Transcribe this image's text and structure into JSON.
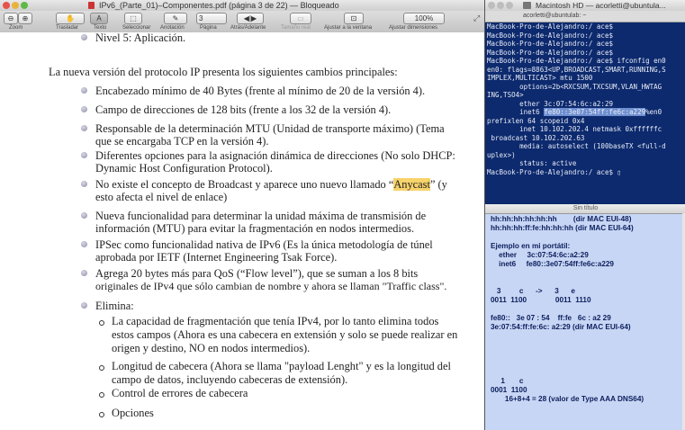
{
  "pdf_window": {
    "title": "IPv6_(Parte_01)–Componentes.pdf (página 3 de 22) — Bloqueado",
    "toolbar": {
      "zoom_label": "Zoom",
      "pan_label": "Trasladar",
      "text_label": "Texto",
      "select_label": "Seleccionar",
      "annotate_label": "Anotación",
      "page_label": "Página",
      "page_value": "3",
      "back_forward_label": "Atrás/Adelante",
      "actual_size_label": "Tamaño real",
      "fit_window_label": "Ajustar a la ventana",
      "zoom_value": "100%",
      "fit_dimensions_label": "Ajustar dimensiones"
    },
    "content": {
      "top_item": "Nivel 5: Aplicación.",
      "intro": "La nueva versión del protocolo IP presenta los siguientes cambios principales:",
      "bullets": [
        {
          "line1": "Encabezado mínimo de 40 Bytes (frente al mínimo de 20 de la versión 4)."
        },
        {
          "line1": "Campo de direcciones de 128 bits (frente a los 32 de la versión 4)."
        },
        {
          "line1": "Responsable de la determinación MTU (Unidad de transporte máximo) (Tema",
          "line2": "que se encargaba TCP en la versión 4)."
        },
        {
          "line1": "Diferentes opciones para la asignación dinámica de direcciones (No solo DHCP:",
          "line2": "Dynamic Host Configuration Protocol)."
        },
        {
          "line1_pre": "No existe el concepto de Broadcast y aparece uno nuevo llamado “",
          "line1_hl": "Anycast",
          "line1_post": "” (y",
          "line2": "esto afecta el nivel de enlace)"
        },
        {
          "line1": "Nueva funcionalidad para determinar la unidad máxima de transmisión de",
          "line2": "información (MTU) para evitar la fragmentación en nodos intermedios."
        },
        {
          "line1": "IPSec como funcionalidad nativa de IPv6 (Es la única metodología de túnel",
          "line2": "aprobada por IETF (Internet Engineering Tsak Force)."
        },
        {
          "line1": "Agrega 20 bytes más para QoS (“Flow level”), que se suman a los 8 bits",
          "line2": "originales de IPv4 que sólo cambian de nombre y ahora se llaman \"Traffic class\"."
        },
        {
          "line1": "Elimina:"
        }
      ],
      "sub_bullets": [
        {
          "line1": "La capacidad de fragmentación que tenía IPv4, por lo tanto elimina todos",
          "line2": "estos campos (Ahora es una cabecera en extensión y solo se puede realizar en",
          "line3": "origen y destino, NO en nodos intermedios)."
        },
        {
          "line1": "Longitud de cabecera (Ahora se llama \"payload Lenght\" y es la longitud del",
          "line2": "campo de datos, incluyendo cabeceras de extensión)."
        },
        {
          "line1": "Control de errores de cabecera"
        },
        {
          "line1": "Opciones"
        }
      ]
    }
  },
  "terminal_window": {
    "title": "Macintosh HD — acorletti@ubuntula...",
    "tab": "acorletti@ubuntulab: ~",
    "lines": [
      "MacBook-Pro-de-Alejandro:/ ace$",
      "MacBook-Pro-de-Alejandro:/ ace$",
      "MacBook-Pro-de-Alejandro:/ ace$",
      "MacBook-Pro-de-Alejandro:/ ace$",
      "MacBook-Pro-de-Alejandro:/ ace$ ifconfig en0",
      "en0: flags=8863<UP,BROADCAST,SMART,RUNNING,S",
      "IMPLEX,MULTICAST> mtu 1500",
      "        options=2b<RXCSUM,TXCSUM,VLAN_HWTAG",
      "ING,TSO4>",
      "        ether 3c:07:54:6c:a2:29"
    ],
    "inet6_prefix": "        inet6 ",
    "inet6_selected": "fe80::3e07:54ff:fe6c:a229",
    "inet6_suffix": "%en0",
    "lines2": [
      "prefixlen 64 scopeid 0x4",
      "        inet 10.102.202.4 netmask 0xffffffc",
      " broadcast 10.102.202.63",
      "        media: autoselect (100baseTX <full-d",
      "uplex>)",
      "        status: active",
      "MacBook-Pro-de-Alejandro:/ ace$ ▯"
    ]
  },
  "notes_window": {
    "title": "Sin título",
    "lines": [
      "hh:hh:hh:hh:hh:hh        (dir MAC EUI-48)",
      "hh:hh:hh:ff:fe:hh:hh:hh (dir MAC EUI-64)",
      "",
      "Ejemplo en mi portátil:",
      "    ether     3c:07:54:6c:a2:29",
      "    inet6     fe80::3e07:54ff:fe6c:a229",
      "",
      "",
      "   3         c      ->      3      e",
      "0011  1100              0011  1110",
      "",
      "fe80::   3e 07 : 54    ff:fe   6c : a2 29",
      "3e:07:54:ff:fe:6c: a2:29 (dir MAC EUI-64)",
      "",
      "",
      "",
      "",
      "",
      "     1       c",
      "0001  1100",
      "       16+8+4 = 28 (valor de Type AAA DNS64)"
    ]
  }
}
